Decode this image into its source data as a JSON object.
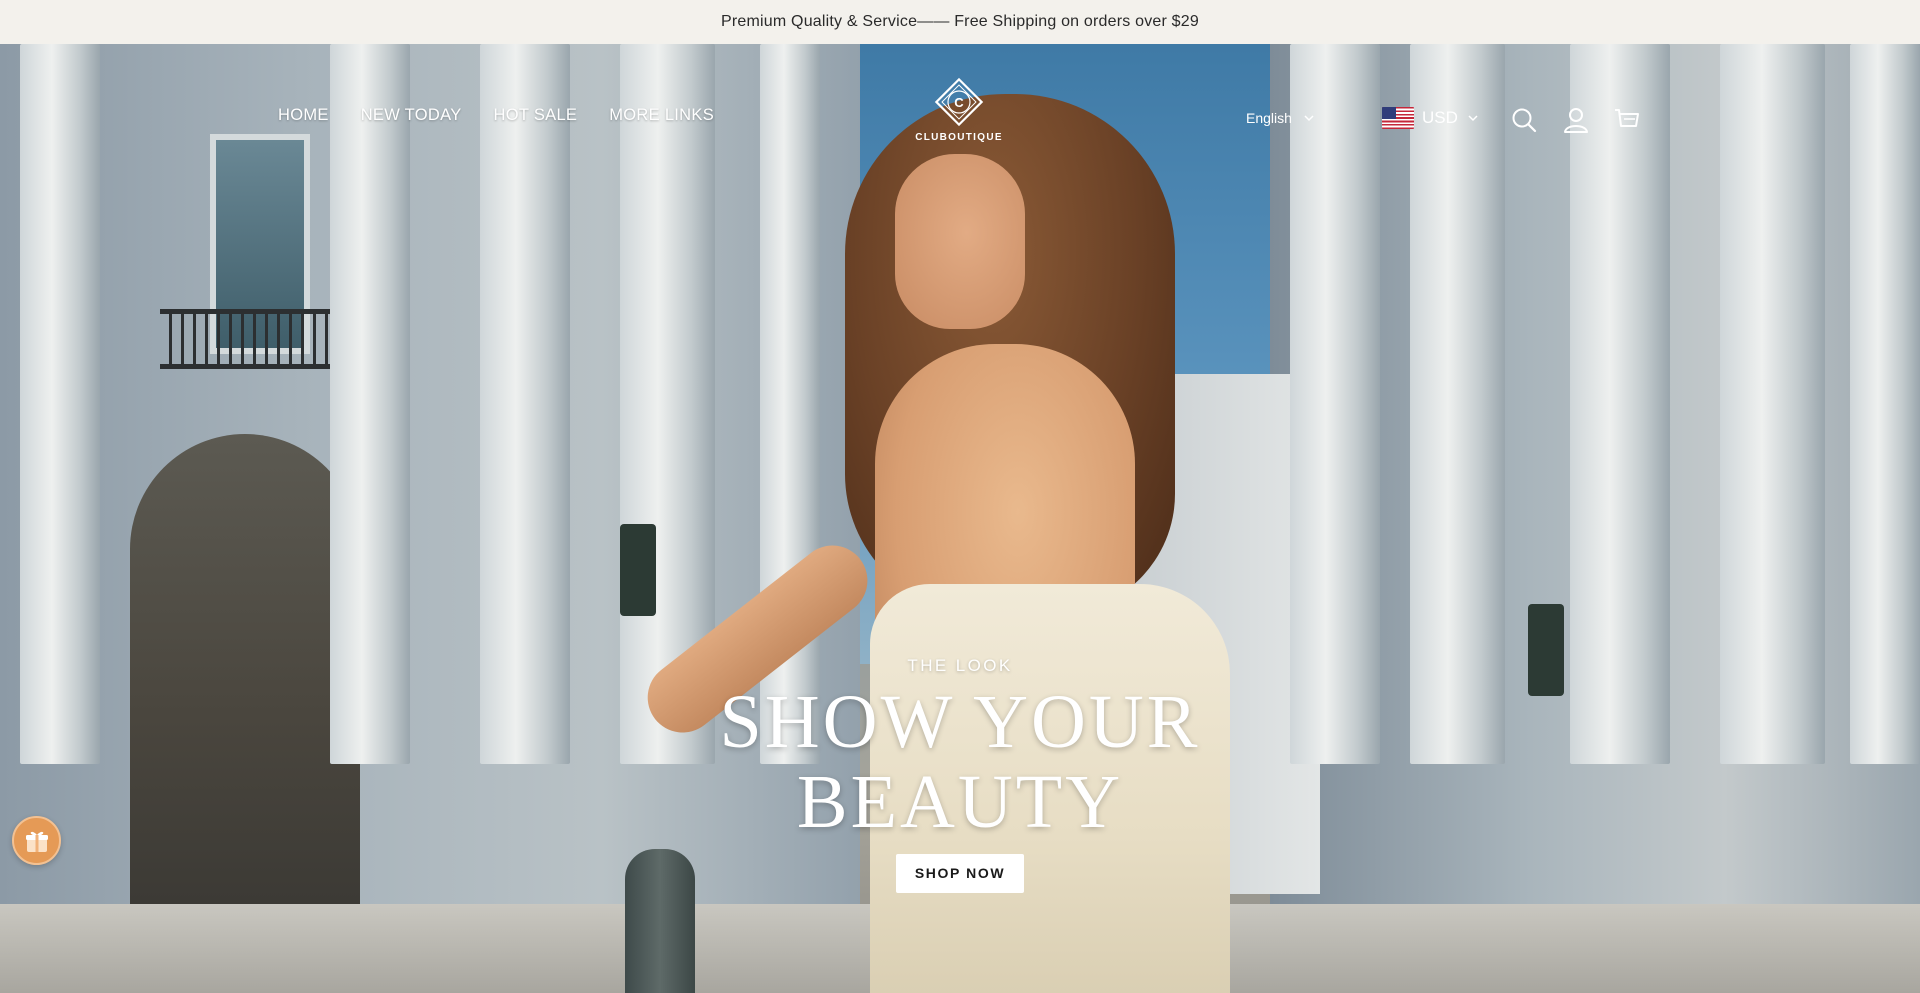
{
  "announcement": {
    "text": "Premium Quality & Service—— Free Shipping on orders over $29"
  },
  "nav": {
    "items": [
      {
        "label": "HOME"
      },
      {
        "label": "NEW TODAY"
      },
      {
        "label": "HOT SALE"
      },
      {
        "label": "MORE LINKS"
      }
    ]
  },
  "brand": {
    "logo_letter": "C",
    "name": "CLUBOUTIQUE"
  },
  "language": {
    "selected": "English"
  },
  "currency": {
    "selected": "USD",
    "flag": "us-flag-icon"
  },
  "header_icons": [
    "search-icon",
    "account-icon",
    "cart-icon"
  ],
  "hero": {
    "eyebrow": "THE LOOK",
    "headline_line1": "SHOW YOUR",
    "headline_line2": "BEAUTY",
    "cta_label": "SHOP NOW"
  },
  "floating": {
    "gift_icon": "gift-icon",
    "gift_color": "#e59a56"
  },
  "colors": {
    "announcement_bg": "#f3f1ec",
    "header_text": "#ffffff",
    "cta_bg": "#ffffff",
    "cta_text": "#1a1a1a"
  }
}
